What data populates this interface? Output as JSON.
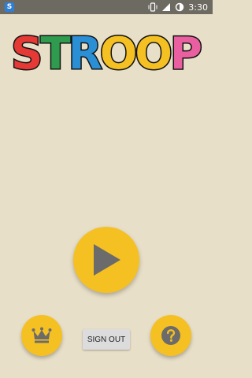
{
  "status_bar": {
    "app_icon_letter": "S",
    "time": "3:30",
    "icons": [
      "vibrate-icon",
      "signal-icon",
      "battery-icon"
    ]
  },
  "logo": {
    "letters": [
      {
        "char": "S",
        "color": "#e53935"
      },
      {
        "char": "T",
        "color": "#2e9b4e"
      },
      {
        "char": "R",
        "color": "#2b8fd6"
      },
      {
        "char": "O",
        "color": "#f5c022"
      },
      {
        "char": "O",
        "color": "#f5c022"
      },
      {
        "char": "P",
        "color": "#ea5fa0"
      }
    ]
  },
  "buttons": {
    "play_icon": "play-icon",
    "leaderboard_icon": "crown-icon",
    "signout_label": "SIGN OUT",
    "help_icon": "question-icon"
  },
  "colors": {
    "background": "#e8dfc8",
    "accent": "#f5c022",
    "icon": "#6b6b6b",
    "status_bar": "#6d6a62"
  }
}
